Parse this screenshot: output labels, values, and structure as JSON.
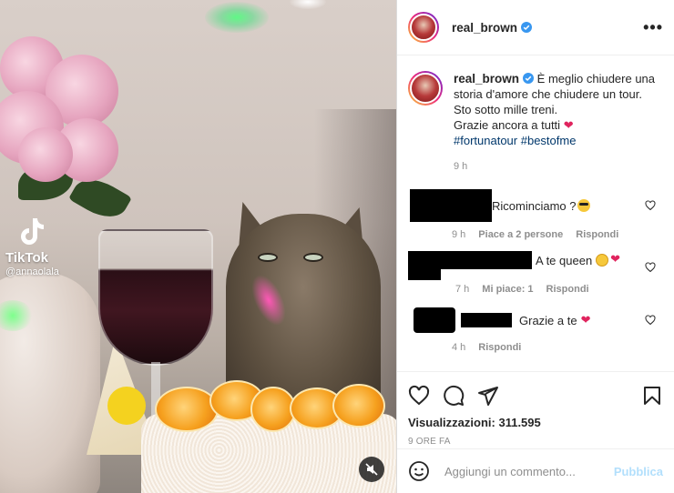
{
  "post": {
    "username": "real_brown",
    "more_label": "•••"
  },
  "media": {
    "watermark_brand": "TikTok",
    "watermark_handle": "@annaolala"
  },
  "caption": {
    "username": "real_brown",
    "text_line1": "È meglio chiudere una storia d'amore che chiudere un tour.",
    "text_line2": "Sto sotto mille treni.",
    "text_line3": "Grazie ancora a tutti",
    "hashtag1": "#fortunatour",
    "hashtag2": "#bestofme",
    "time": "9 h"
  },
  "comments": [
    {
      "text": "Ricominciamo ?",
      "time": "9 h",
      "likes": "Piace a 2 persone",
      "reply": "Rispondi"
    },
    {
      "text": "A te queen",
      "time": "7 h",
      "likes": "Mi piace: 1",
      "reply": "Rispondi"
    },
    {
      "text": "Grazie a te",
      "time": "4 h",
      "reply": "Rispondi"
    }
  ],
  "stats": {
    "views_label": "Visualizzazioni:",
    "views_value": "311.595",
    "posted": "9 ORE FA"
  },
  "composer": {
    "placeholder": "Aggiungi un commento...",
    "publish_label": "Pubblica"
  },
  "colors": {
    "verified": "#3897f0",
    "heart": "#e0245e",
    "hashtag": "#00376b",
    "publish_disabled": "#b2dffc"
  }
}
